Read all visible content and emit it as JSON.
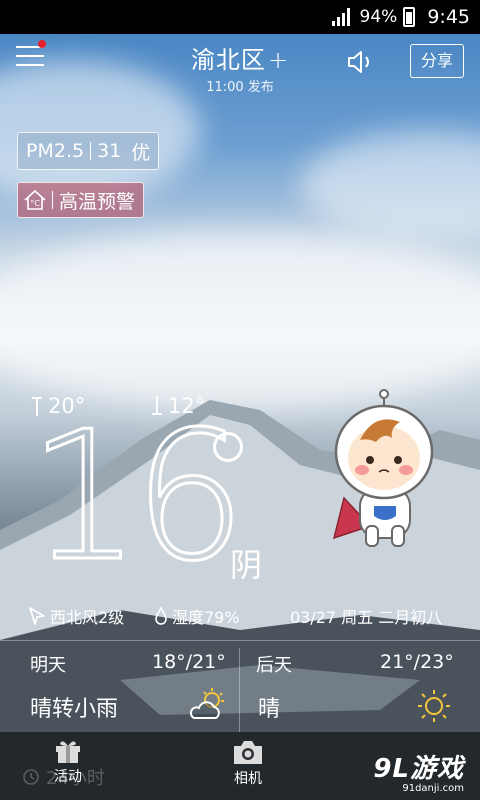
{
  "status_bar": {
    "battery": "94%",
    "time": "9:45"
  },
  "header": {
    "city": "渝北区",
    "add_symbol": "+",
    "publish_time": "11:00 发布",
    "share_label": "分享"
  },
  "aqi": {
    "label": "PM2.5",
    "value": "31",
    "level": "优"
  },
  "alert": {
    "label": "高温预警"
  },
  "current": {
    "high": "20°",
    "low": "12°",
    "temp": "16",
    "condition": "阴",
    "wind": "西北风2级",
    "humidity": "湿度79%",
    "date": "03/27 周五 二月初八"
  },
  "forecast": [
    {
      "day": "明天",
      "range": "18°/21°",
      "desc": "晴转小雨",
      "icon": "cloud-sun-icon"
    },
    {
      "day": "后天",
      "range": "21°/23°",
      "desc": "晴",
      "icon": "sun-icon"
    }
  ],
  "bottom_bar": {
    "tabs": [
      {
        "label": "活动",
        "icon": "gift-icon"
      },
      {
        "label": "相机",
        "icon": "camera-icon"
      }
    ],
    "ghost_text": "24小时",
    "watermark": {
      "brand": "9L游戏",
      "url": "91danji.com"
    }
  }
}
